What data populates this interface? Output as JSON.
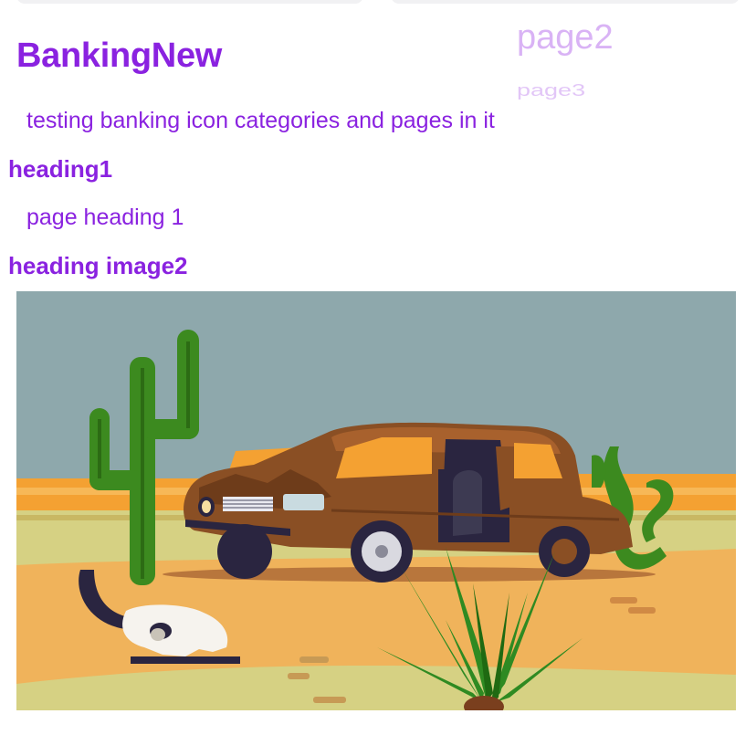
{
  "header": {
    "title": "BankingNew",
    "page_links": [
      "page2",
      "page3"
    ]
  },
  "intro": {
    "subtitle": "testing banking icon categories and pages in it"
  },
  "sections": [
    {
      "heading": "heading1",
      "body": "page heading 1"
    },
    {
      "heading": "heading image2"
    }
  ],
  "illustration": {
    "icon": "desert-wrecked-car-illustration",
    "colors": {
      "sky": "#8ea8ac",
      "sand_orange": "#f4a132",
      "sand_light": "#d6d183",
      "sand_mid": "#f0b35b",
      "cactus": "#3c8a1f",
      "car_body": "#8a4f24",
      "car_dark": "#2a2540"
    }
  },
  "theme": {
    "accent": "#8a22e0",
    "accent_light": "#d9b3f5"
  }
}
